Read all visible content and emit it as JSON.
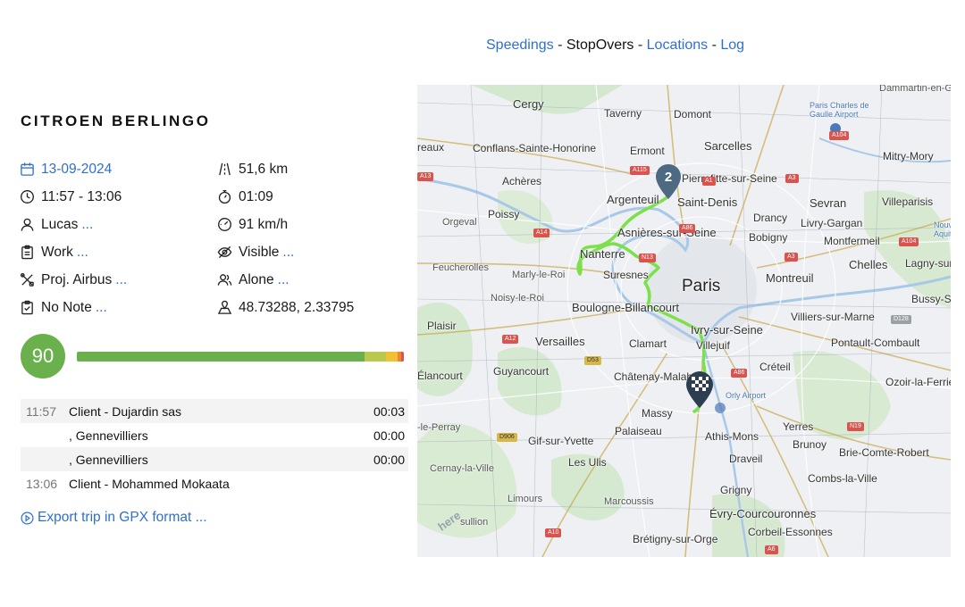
{
  "nav": {
    "speedings": "Speedings",
    "stopovers": "StopOvers",
    "locations": "Locations",
    "log": "Log",
    "separator": " - "
  },
  "vehicle": {
    "name": "CITROEN BERLINGO"
  },
  "trip": {
    "date": "13-09-2024",
    "time_range": "11:57 - 13:06",
    "driver": "Lucas",
    "category": "Work",
    "project": "Proj. Airbus",
    "note": "No Note",
    "distance": "51,6 km",
    "duration": "01:09",
    "max_speed": "91 km/h",
    "visibility": "Visible",
    "company": "Alone",
    "coordinates": "48.73288, 2.33795",
    "more": "..."
  },
  "score": {
    "value": "90",
    "color": "#6ab04c",
    "bar": [
      {
        "fraction": 0.88,
        "color": "#6ab04c"
      },
      {
        "fraction": 0.065,
        "color": "#b9c94e"
      },
      {
        "fraction": 0.035,
        "color": "#f2c037"
      },
      {
        "fraction": 0.012,
        "color": "#e8892e"
      },
      {
        "fraction": 0.008,
        "color": "#d9534f"
      }
    ]
  },
  "stops": [
    {
      "time": "11:57",
      "name": "Client - Dujardin sas",
      "duration": "00:03"
    },
    {
      "time": "",
      "name": ", Gennevilliers",
      "duration": "00:00"
    },
    {
      "time": "",
      "name": ", Gennevilliers",
      "duration": "00:00"
    },
    {
      "time": "13:06",
      "name": "Client - Mohammed Mokaata",
      "duration": ""
    }
  ],
  "export": {
    "label": "Export trip in GPX format ..."
  },
  "map": {
    "route_color": "#7be04a",
    "marker_count": "2",
    "attribution": "here",
    "labels": {
      "cergy": "Cergy",
      "taverny": "Taverny",
      "domont": "Domont",
      "dammartin": "Dammartin-en-G",
      "roissy": "Paris Charles de\nGaulle Airport",
      "reaux": "reaux",
      "conflans": "Conflans-Sainte-Honorine",
      "ermont": "Ermont",
      "sarcelles": "Sarcelles",
      "mitry": "Mitry-Mory",
      "acheres": "Achères",
      "pierrefitte": "Pierrefitte-sur-Seine",
      "argenteuil": "Argenteuil",
      "saintdenis": "Saint-Denis",
      "sevran": "Sevran",
      "villeparisis": "Villeparisis",
      "orgeval": "Orgeval",
      "poissy": "Poissy",
      "drancy": "Drancy",
      "livry": "Livry-Gargan",
      "asnieres": "Asnières-sur-Seine",
      "bobigny": "Bobigny",
      "montfermeil": "Montfermeil",
      "nouvelle": "Nouve\nAquita",
      "feucherolles": "Feucherolles",
      "nanterre": "Nanterre",
      "chelles": "Chelles",
      "lagny": "Lagny-sur-",
      "marly": "Marly-le-Roi",
      "suresnes": "Suresnes",
      "paris": "Paris",
      "montreuil": "Montreuil",
      "noisy": "Noisy-le-Roi",
      "bussy": "Bussy-Saint-C",
      "boulogne": "Boulogne-Billancourt",
      "villiers": "Villiers-sur-Marne",
      "plaisir": "Plaisir",
      "ivry": "Ivry-sur-Seine",
      "versailles": "Versailles",
      "villejuif": "Villejuif",
      "clamart": "Clamart",
      "pontault": "Pontault-Combault",
      "elancourt": "Élancourt",
      "guyancourt": "Guyancourt",
      "chatenay": "Châtenay-Malabry",
      "creteil": "Créteil",
      "orly": "Orly Airport",
      "ozoir": "Ozoir-la-Ferrie",
      "massy": "Massy",
      "leperray": "-le-Perray",
      "palaiseau": "Palaiseau",
      "athis": "Athis-Mons",
      "yerres": "Yerres",
      "brunoy": "Brunoy",
      "gif": "Gif-sur-Yvette",
      "brie": "Brie-Comte-Robert",
      "lesulis": "Les Ulis",
      "draveil": "Draveil",
      "cernay": "Cernay-la-Ville",
      "combs": "Combs-la-Ville",
      "grigny": "Grigny",
      "limours": "Limours",
      "marcoussis": "Marcoussis",
      "evry": "Évry-Courcouronnes",
      "sullion": "sullion",
      "corbeil": "Corbeil-Essonnes",
      "bretigny": "Brétigny-sur-Orge"
    },
    "shields": {
      "a115": "A115",
      "a104a": "A104",
      "a13": "A13",
      "a1": "A1",
      "a3a": "A3",
      "a104b": "A104",
      "a14": "A14",
      "a86a": "A86",
      "a3b": "A3",
      "n13": "N13",
      "d128": "D128",
      "a12": "A12",
      "d53": "D53",
      "a86b": "A86",
      "d906": "D906",
      "n19": "N19",
      "a10": "A10",
      "a6": "A6"
    }
  }
}
